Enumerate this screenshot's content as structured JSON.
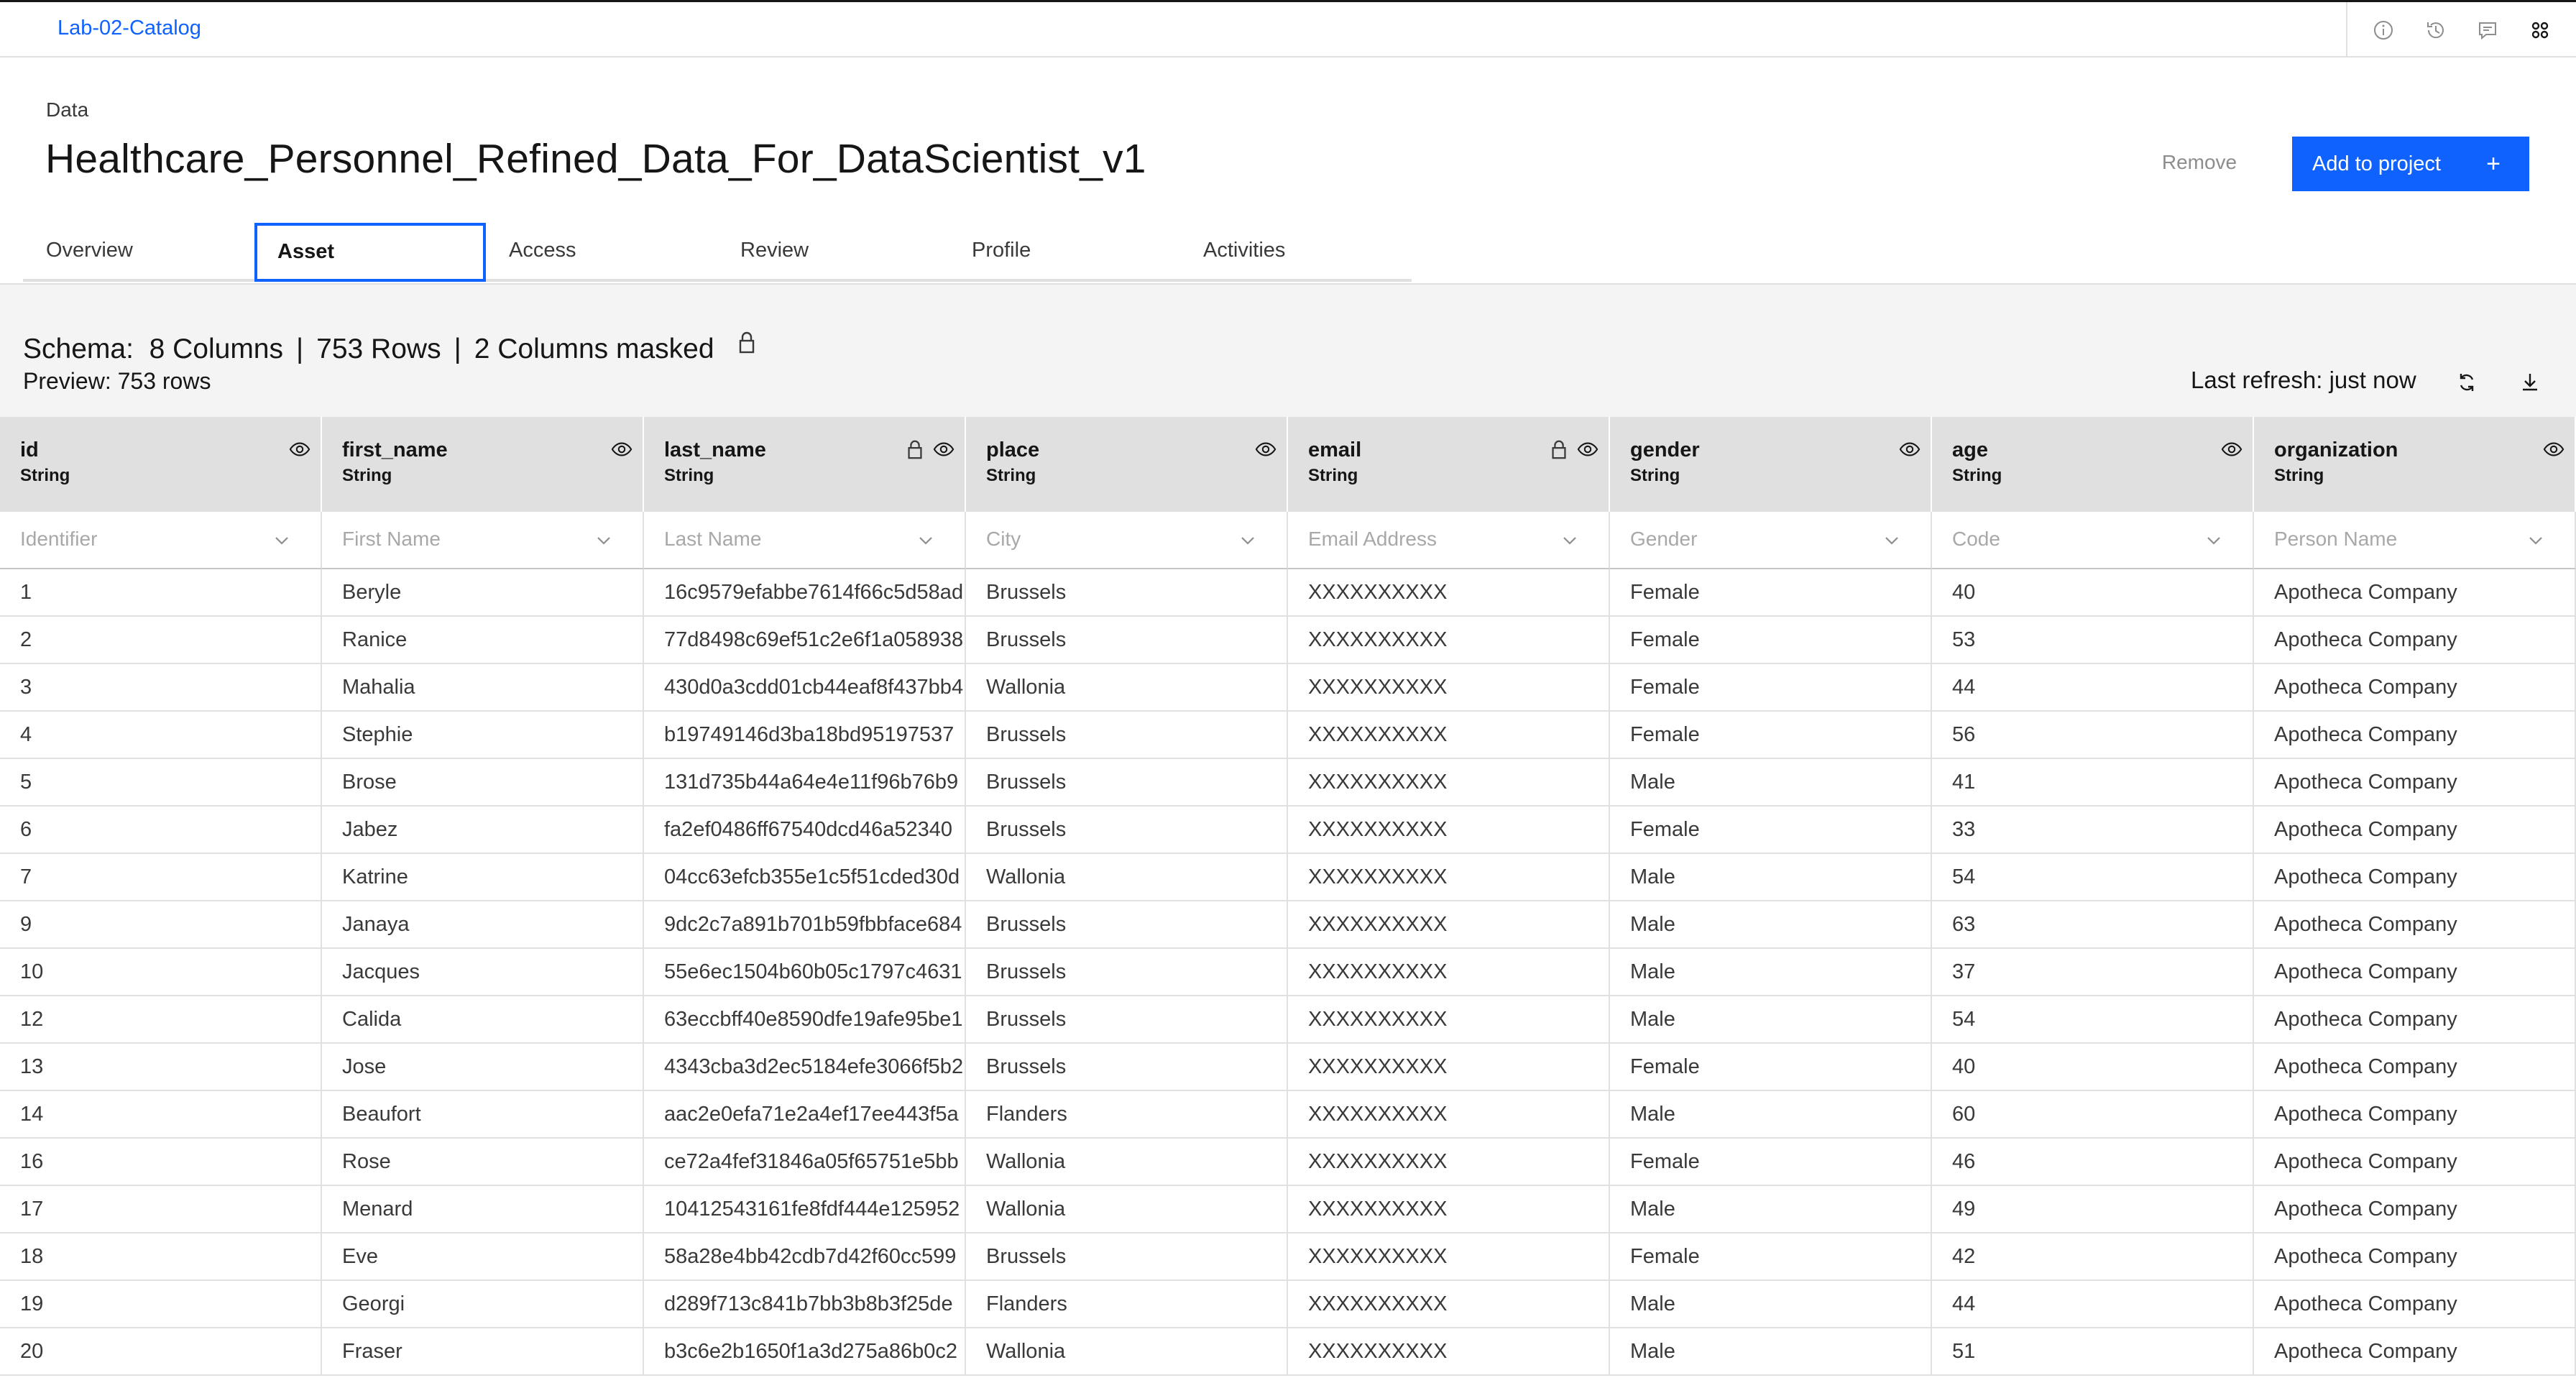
{
  "topbar": {
    "breadcrumb": "Lab-02-Catalog",
    "icons": [
      "info-icon",
      "history-icon",
      "chat-icon",
      "apps-icon"
    ]
  },
  "header": {
    "subtitle": "Data",
    "title": "Healthcare_Personnel_Refined_Data_For_DataScientist_v1",
    "remove_label": "Remove",
    "add_label": "Add to project",
    "add_icon": "+"
  },
  "tabs": [
    {
      "label": "Overview"
    },
    {
      "label": "Asset"
    },
    {
      "label": "Access"
    },
    {
      "label": "Review"
    },
    {
      "label": "Profile"
    },
    {
      "label": "Activities"
    }
  ],
  "active_tab": "Asset",
  "schema": {
    "prefix": "Schema:",
    "columns": "8 Columns",
    "rows": "753 Rows",
    "masked": "2 Columns masked",
    "sep": "|",
    "preview": "Preview: 753 rows",
    "refresh": "Last refresh: just now"
  },
  "columns": [
    {
      "name": "id",
      "type": "String",
      "filter": "Identifier",
      "masked": false
    },
    {
      "name": "first_name",
      "type": "String",
      "filter": "First Name",
      "masked": false
    },
    {
      "name": "last_name",
      "type": "String",
      "filter": "Last Name",
      "masked": true
    },
    {
      "name": "place",
      "type": "String",
      "filter": "City",
      "masked": false
    },
    {
      "name": "email",
      "type": "String",
      "filter": "Email Address",
      "masked": true
    },
    {
      "name": "gender",
      "type": "String",
      "filter": "Gender",
      "masked": false
    },
    {
      "name": "age",
      "type": "String",
      "filter": "Code",
      "masked": false
    },
    {
      "name": "organization",
      "type": "String",
      "filter": "Person Name",
      "masked": false
    }
  ],
  "rows": [
    [
      "1",
      "Beryle",
      "16c9579efabbe7614f66c5d58ad",
      "Brussels",
      "XXXXXXXXXX",
      "Female",
      "40",
      "Apotheca Company"
    ],
    [
      "2",
      "Ranice",
      "77d8498c69ef51c2e6f1a058938",
      "Brussels",
      "XXXXXXXXXX",
      "Female",
      "53",
      "Apotheca Company"
    ],
    [
      "3",
      "Mahalia",
      "430d0a3cdd01cb44eaf8f437bb4",
      "Wallonia",
      "XXXXXXXXXX",
      "Female",
      "44",
      "Apotheca Company"
    ],
    [
      "4",
      "Stephie",
      "b19749146d3ba18bd95197537",
      "Brussels",
      "XXXXXXXXXX",
      "Female",
      "56",
      "Apotheca Company"
    ],
    [
      "5",
      "Brose",
      "131d735b44a64e4e11f96b76b9",
      "Brussels",
      "XXXXXXXXXX",
      "Male",
      "41",
      "Apotheca Company"
    ],
    [
      "6",
      "Jabez",
      "fa2ef0486ff67540dcd46a52340",
      "Brussels",
      "XXXXXXXXXX",
      "Female",
      "33",
      "Apotheca Company"
    ],
    [
      "7",
      "Katrine",
      "04cc63efcb355e1c5f51cded30d",
      "Wallonia",
      "XXXXXXXXXX",
      "Male",
      "54",
      "Apotheca Company"
    ],
    [
      "9",
      "Janaya",
      "9dc2c7a891b701b59fbbface684",
      "Brussels",
      "XXXXXXXXXX",
      "Male",
      "63",
      "Apotheca Company"
    ],
    [
      "10",
      "Jacques",
      "55e6ec1504b60b05c1797c4631",
      "Brussels",
      "XXXXXXXXXX",
      "Male",
      "37",
      "Apotheca Company"
    ],
    [
      "12",
      "Calida",
      "63eccbff40e8590dfe19afe95be1",
      "Brussels",
      "XXXXXXXXXX",
      "Male",
      "54",
      "Apotheca Company"
    ],
    [
      "13",
      "Jose",
      "4343cba3d2ec5184efe3066f5b2",
      "Brussels",
      "XXXXXXXXXX",
      "Female",
      "40",
      "Apotheca Company"
    ],
    [
      "14",
      "Beaufort",
      "aac2e0efa71e2a4ef17ee443f5a",
      "Flanders",
      "XXXXXXXXXX",
      "Male",
      "60",
      "Apotheca Company"
    ],
    [
      "16",
      "Rose",
      "ce72a4fef31846a05f65751e5bb",
      "Wallonia",
      "XXXXXXXXXX",
      "Female",
      "46",
      "Apotheca Company"
    ],
    [
      "17",
      "Menard",
      "10412543161fe8fdf444e125952",
      "Wallonia",
      "XXXXXXXXXX",
      "Male",
      "49",
      "Apotheca Company"
    ],
    [
      "18",
      "Eve",
      "58a28e4bb42cdb7d42f60cc599",
      "Brussels",
      "XXXXXXXXXX",
      "Female",
      "42",
      "Apotheca Company"
    ],
    [
      "19",
      "Georgi",
      "d289f713c841b7bb3b8b3f25de",
      "Flanders",
      "XXXXXXXXXX",
      "Male",
      "44",
      "Apotheca Company"
    ],
    [
      "20",
      "Fraser",
      "b3c6e2b1650f1a3d275a86b0c2",
      "Wallonia",
      "XXXXXXXXXX",
      "Male",
      "51",
      "Apotheca Company"
    ]
  ],
  "colors": {
    "accent": "#0f62fe",
    "header_bg": "#e0e0e0",
    "band_bg": "#f4f4f4"
  }
}
